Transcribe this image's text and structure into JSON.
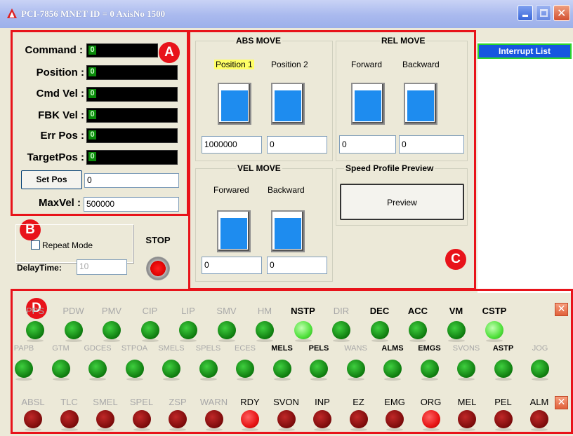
{
  "window": {
    "title": "PCI-7856 MNET ID = 0 AxisNo 1500"
  },
  "badges": {
    "a": "A",
    "b": "B",
    "c": "C",
    "d": "D"
  },
  "status": {
    "command": {
      "label": "Command :",
      "value": "0"
    },
    "position": {
      "label": "Position :",
      "value": "0"
    },
    "cmd_vel": {
      "label": "Cmd Vel :",
      "value": "0"
    },
    "fbk_vel": {
      "label": "FBK Vel :",
      "value": "0"
    },
    "err_pos": {
      "label": "Err Pos :",
      "value": "0"
    },
    "target_pos": {
      "label": "TargetPos :",
      "value": "0"
    },
    "set_pos": {
      "button": "Set Pos",
      "value": "0"
    },
    "max_vel": {
      "label": "MaxVel :",
      "value": "500000"
    }
  },
  "repeat": {
    "checkbox_label": "Repeat Mode",
    "delay_label": "DelayTime:",
    "delay_value": "10",
    "stop_label": "STOP"
  },
  "abs_move": {
    "title": "ABS MOVE",
    "pos1": "Position 1",
    "pos2": "Position 2",
    "val1": "1000000",
    "val2": "0"
  },
  "rel_move": {
    "title": "REL MOVE",
    "fwd": "Forward",
    "bwd": "Backward",
    "val1": "0",
    "val2": "0"
  },
  "vel_move": {
    "title": "VEL MOVE",
    "fwd": "Forwared",
    "bwd": "Backward",
    "val1": "0",
    "val2": "0"
  },
  "speed_profile": {
    "title": "Speed Profile Preview",
    "button": "Preview"
  },
  "interrupt": {
    "button": "Interrupt List"
  },
  "io_row1": [
    {
      "label": "PPS",
      "style": "dim",
      "led": "g"
    },
    {
      "label": "PDW",
      "style": "dim",
      "led": "g"
    },
    {
      "label": "PMV",
      "style": "dim",
      "led": "g"
    },
    {
      "label": "CIP",
      "style": "dim",
      "led": "g"
    },
    {
      "label": "LIP",
      "style": "dim",
      "led": "g"
    },
    {
      "label": "SMV",
      "style": "dim",
      "led": "g"
    },
    {
      "label": "HM",
      "style": "dim",
      "led": "g"
    },
    {
      "label": "NSTP",
      "style": "bold",
      "led": "bg"
    },
    {
      "label": "DIR",
      "style": "dim",
      "led": "g"
    },
    {
      "label": "DEC",
      "style": "bold",
      "led": "g"
    },
    {
      "label": "ACC",
      "style": "bold",
      "led": "g"
    },
    {
      "label": "VM",
      "style": "bold",
      "led": "g"
    },
    {
      "label": "CSTP",
      "style": "bold",
      "led": "bg"
    }
  ],
  "io_row2": [
    {
      "label": "PAPB",
      "style": "dim",
      "led": "g"
    },
    {
      "label": "GTM",
      "style": "dim",
      "led": "g"
    },
    {
      "label": "GDCES",
      "style": "dim",
      "led": "g"
    },
    {
      "label": "STPOA",
      "style": "dim",
      "led": "g"
    },
    {
      "label": "SMELS",
      "style": "dim",
      "led": "g"
    },
    {
      "label": "SPELS",
      "style": "dim",
      "led": "g"
    },
    {
      "label": "ECES",
      "style": "dim",
      "led": "g"
    },
    {
      "label": "MELS",
      "style": "bold",
      "led": "g"
    },
    {
      "label": "PELS",
      "style": "bold",
      "led": "g"
    },
    {
      "label": "WANS",
      "style": "dim",
      "led": "g"
    },
    {
      "label": "ALMS",
      "style": "bold",
      "led": "g"
    },
    {
      "label": "EMGS",
      "style": "bold",
      "led": "g"
    },
    {
      "label": "SVONS",
      "style": "dim",
      "led": "g"
    },
    {
      "label": "ASTP",
      "style": "bold",
      "led": "g"
    },
    {
      "label": "JOG",
      "style": "dim",
      "led": "g"
    }
  ],
  "io_row3": [
    {
      "label": "ABSL",
      "style": "dim",
      "led": "r"
    },
    {
      "label": "TLC",
      "style": "dim",
      "led": "r"
    },
    {
      "label": "SMEL",
      "style": "dim",
      "led": "r"
    },
    {
      "label": "SPEL",
      "style": "dim",
      "led": "r"
    },
    {
      "label": "ZSP",
      "style": "dim",
      "led": "r"
    },
    {
      "label": "WARN",
      "style": "dim",
      "led": "r"
    },
    {
      "label": "RDY",
      "style": "normal",
      "led": "br"
    },
    {
      "label": "SVON",
      "style": "normal",
      "led": "r"
    },
    {
      "label": "INP",
      "style": "normal",
      "led": "r"
    },
    {
      "label": "EZ",
      "style": "normal",
      "led": "r"
    },
    {
      "label": "EMG",
      "style": "normal",
      "led": "r"
    },
    {
      "label": "ORG",
      "style": "normal",
      "led": "br"
    },
    {
      "label": "MEL",
      "style": "normal",
      "led": "r"
    },
    {
      "label": "PEL",
      "style": "normal",
      "led": "r"
    },
    {
      "label": "ALM",
      "style": "normal",
      "led": "r"
    }
  ],
  "colors": {
    "highlight": "#e8131a",
    "led_green": "#0e7a0e",
    "led_bright_green": "#4fe03a",
    "led_red": "#7a0a0a",
    "led_bright_red": "#e61414",
    "tank_blue": "#1e8cef"
  }
}
